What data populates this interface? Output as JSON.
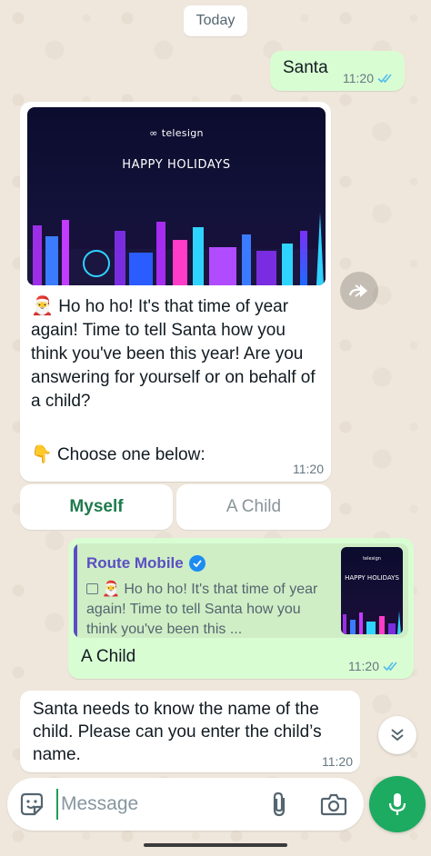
{
  "date_chip": "Today",
  "messages": {
    "santa": {
      "text": "Santa",
      "time": "11:20"
    },
    "promo": {
      "brand": "telesign",
      "image_heading": "HAPPY HOLIDAYS",
      "text": "Ho ho ho! It's that time of year again! Time to tell Santa how you think you've been this year! Are you answering for yourself or on behalf of a child?",
      "choose": "Choose one below:",
      "time": "11:20"
    },
    "reply": {
      "quoted_sender": "Route Mobile",
      "quoted_text": "Ho ho ho! It's that time of year again! Time to tell Santa how you think you've been this ...",
      "text": "A Child",
      "time": "11:20"
    },
    "ask": {
      "text": "Santa needs to know the name of the child. Please can you enter the child’s name.",
      "time": "11:20"
    }
  },
  "quick_replies": [
    "Myself",
    "A Child"
  ],
  "composer": {
    "placeholder": "Message"
  },
  "colors": {
    "accent_green": "#1daa61",
    "outgoing_bubble": "#d9fdd3",
    "read_ticks": "#53bdeb",
    "quote_sender": "#5b4ec2"
  }
}
